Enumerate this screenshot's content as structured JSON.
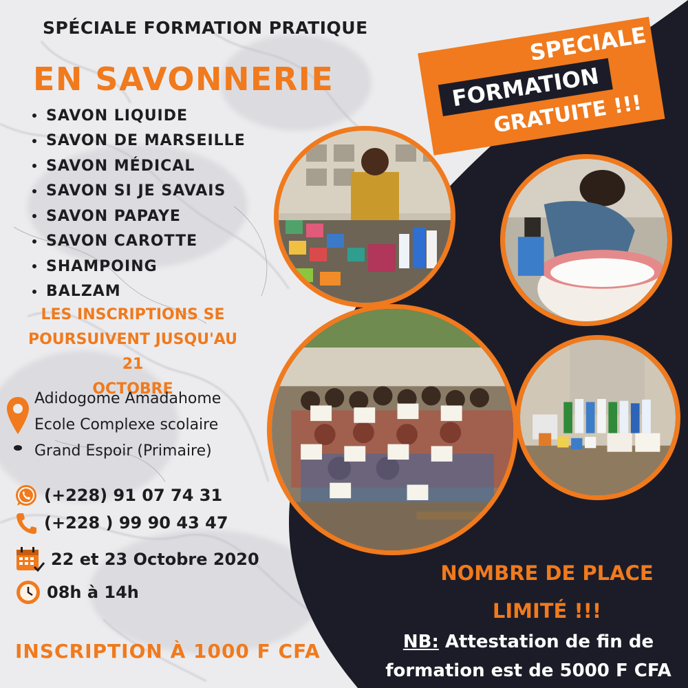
{
  "header": {
    "top_title": "SPÉCIALE FORMATION PRATIQUE",
    "main_title": "EN SAVONNERIE"
  },
  "products": [
    "SAVON LIQUIDE",
    "SAVON DE MARSEILLE",
    "SAVON MÉDICAL",
    "SAVON SI JE SAVAIS",
    "SAVON PAPAYE",
    "SAVON CAROTTE",
    "SHAMPOING",
    "BALZAM"
  ],
  "inscription_notice": {
    "line1": "LES  INSCRIPTIONS SE",
    "line2": "POURSUIVENT JUSQU'AU  21",
    "line3": "OCTOBRE"
  },
  "address": {
    "line1": "Adidogome Amadahome",
    "line2": "Ecole Complexe scolaire",
    "line3": "Grand Espoir (Primaire)"
  },
  "contact": {
    "phone1": "(+228) 91 07 74 31",
    "phone2": "(+228 ) 99 90 43 47"
  },
  "schedule": {
    "date": "22 et 23 Octobre 2020",
    "hours": "08h à 14h"
  },
  "fee": "INSCRIPTION À 1000 F CFA",
  "banner": {
    "line1": "SPECIALE",
    "line2": "FORMATION",
    "line3": "GRATUITE !!!"
  },
  "limited": {
    "line1": "NOMBRE DE PLACE",
    "line2": "LIMITÉ !!!"
  },
  "note": {
    "label": "NB:",
    "text1": " Attestation de fin de",
    "text2": "formation est de 5000 F CFA"
  },
  "colors": {
    "accent": "#f07a1d",
    "dark": "#1c1c28",
    "text": "#1d1d21",
    "marble": "#e9e9ec"
  },
  "icons": [
    "location-pin-icon",
    "whatsapp-icon",
    "phone-icon",
    "calendar-icon",
    "clock-icon"
  ]
}
